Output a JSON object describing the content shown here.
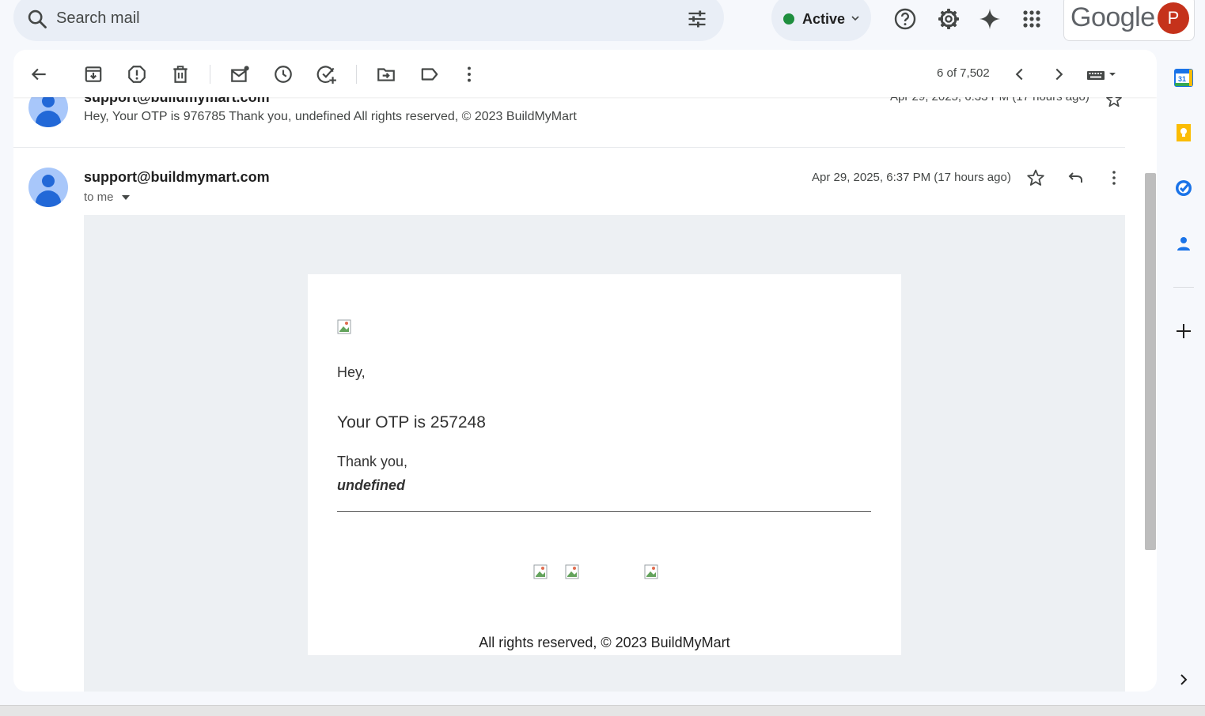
{
  "search": {
    "placeholder": "Search mail"
  },
  "status": {
    "label": "Active",
    "color": "#1e8e3e"
  },
  "account": {
    "brand": "Google",
    "avatar_letter": "P",
    "avatar_color": "#c5321b"
  },
  "toolbar": {
    "pager": "6 of 7,502"
  },
  "thread": {
    "collapsed": {
      "sender": "support@buildmymart.com",
      "snippet": "Hey, Your OTP is 976785 Thank you, undefined All rights reserved, © 2023 BuildMyMart",
      "date": "Apr 29, 2025, 6:33 PM (17 hours ago)"
    },
    "open": {
      "sender": "support@buildmymart.com",
      "recipient": "to me",
      "date": "Apr 29, 2025, 6:37 PM (17 hours ago)",
      "body": {
        "greeting": "Hey,",
        "otp_line": "Your OTP is 257248",
        "thanks": "Thank you,",
        "signature": "undefined",
        "footer": "All rights reserved, © 2023 BuildMyMart"
      }
    }
  },
  "sidepanel": {
    "calendar_day": "31"
  }
}
